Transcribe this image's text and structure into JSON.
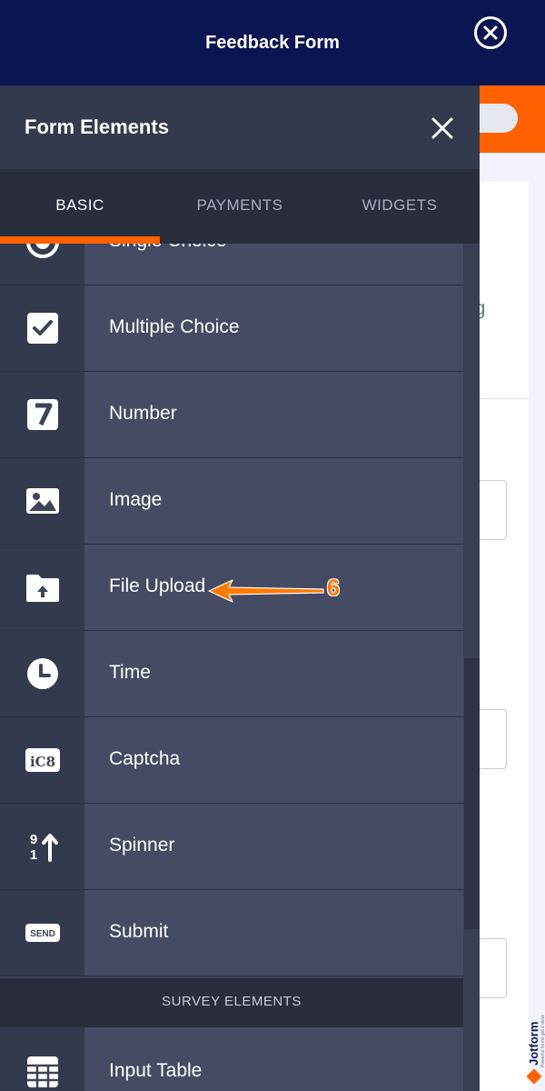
{
  "header": {
    "title": "Feedback Form",
    "close_icon": "close-circle-icon"
  },
  "background": {
    "partial_text": "ng",
    "accent": "#ff6100",
    "brand_name": "Jotform",
    "brand_tagline": "Powerful forms get it done"
  },
  "panel": {
    "title": "Form Elements",
    "close_icon": "close-icon",
    "tabs": [
      {
        "label": "BASIC",
        "active": true
      },
      {
        "label": "PAYMENTS",
        "active": false
      },
      {
        "label": "WIDGETS",
        "active": false
      }
    ],
    "items": [
      {
        "label": "Single Choice",
        "icon": "radio-icon"
      },
      {
        "label": "Multiple Choice",
        "icon": "checkbox-icon"
      },
      {
        "label": "Number",
        "icon": "number-seven-icon"
      },
      {
        "label": "Image",
        "icon": "image-icon"
      },
      {
        "label": "File Upload",
        "icon": "folder-upload-icon"
      },
      {
        "label": "Time",
        "icon": "clock-icon"
      },
      {
        "label": "Captcha",
        "icon": "captcha-icon",
        "icon_text": "iC8"
      },
      {
        "label": "Spinner",
        "icon": "spinner-icon",
        "icon_text_top": "9",
        "icon_text_bottom": "1"
      },
      {
        "label": "Submit",
        "icon": "send-icon",
        "icon_text": "SEND"
      }
    ],
    "section_header": "SURVEY ELEMENTS",
    "survey_items": [
      {
        "label": "Input Table",
        "icon": "table-icon"
      }
    ]
  },
  "annotation": {
    "step_number": "6",
    "color": "#ff7a00"
  }
}
